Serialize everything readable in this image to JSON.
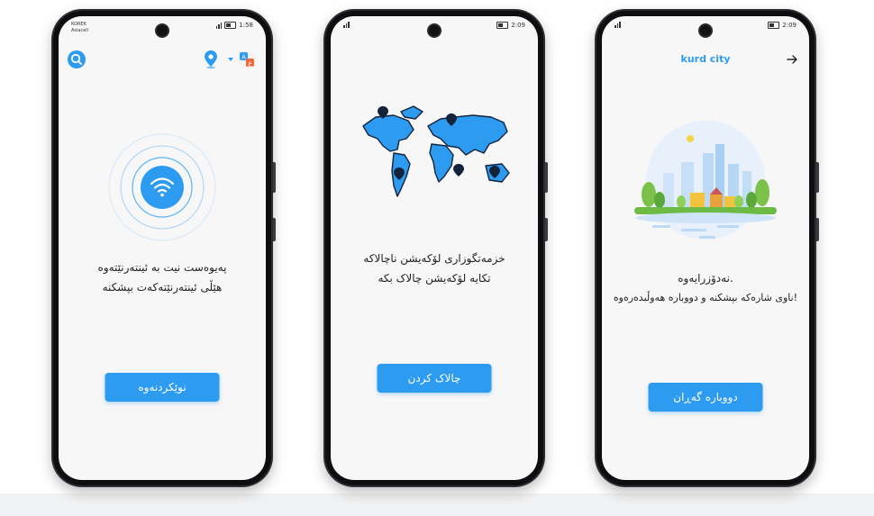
{
  "screens": [
    {
      "status": {
        "carrier_line1": "KOREK",
        "carrier_line2": "Asiacell",
        "time": "1:58"
      },
      "message_line1": "پەیوەست نیت بە ئینتەرنێتەوە",
      "message_line2": "هێڵی ئینتەرنێتەکەت بپشکنە",
      "button_label": "نوێکردنەوە",
      "icons": [
        "search-icon",
        "location-pin-icon",
        "language-icon",
        "wifi-icon"
      ]
    },
    {
      "status": {
        "time": "2:09"
      },
      "message_line1": "خزمەتگوزاری لۆکەیشن ناچالاکە",
      "message_line2": "تکایە لۆکەیشن چالاک بکە",
      "button_label": "چالاک کردن",
      "icons": [
        "world-map-icon"
      ]
    },
    {
      "status": {
        "time": "2:09"
      },
      "header_title": "kurd city",
      "message_line1": "نەدۆزرایەوە.",
      "message_line2": "ناوی شارەکە بپشکنە و دووبارە هەوڵبدەرەوە!",
      "button_label": "دووبارە گەڕان",
      "icons": [
        "arrow-right-icon",
        "city-illustration-icon"
      ]
    }
  ],
  "colors": {
    "accent": "#2d9cf0",
    "screen_bg": "#f7f7f8",
    "frame": "#2b2d31"
  }
}
